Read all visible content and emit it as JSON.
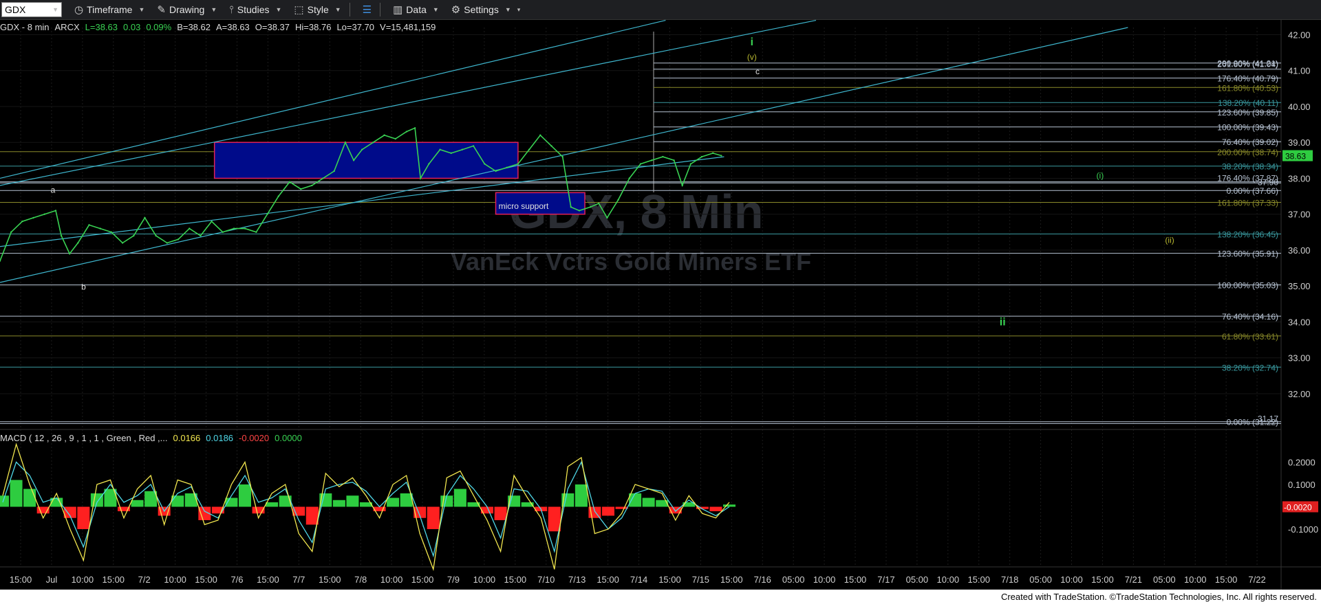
{
  "toolbar": {
    "symbol": "GDX",
    "items": [
      {
        "label": "Timeframe",
        "icon": "clock-icon"
      },
      {
        "label": "Drawing",
        "icon": "pencil-icon"
      },
      {
        "label": "Studies",
        "icon": "studies-icon"
      },
      {
        "label": "Style",
        "icon": "style-icon"
      },
      {
        "label": "",
        "icon": "layout-icon"
      },
      {
        "label": "Data",
        "icon": "data-icon"
      },
      {
        "label": "Settings",
        "icon": "gear-icon"
      }
    ]
  },
  "infobar": {
    "symbol": "GDX - 8 min",
    "exchange": "ARCX",
    "last": "L=38.63",
    "change": "0.03",
    "pct": "0.09%",
    "bid": "B=38.62",
    "ask": "A=38.63",
    "open": "O=38.37",
    "high": "Hi=38.76",
    "low": "Lo=37.70",
    "volume": "V=15,481,159"
  },
  "watermark": {
    "symbol": "GDX, 8 Min",
    "name": "VanEck Vctrs Gold Miners ETF"
  },
  "macd": {
    "label": "MACD ( 12 , 26 , 9 , 1 , 1 , Green , Red ,...",
    "macd_value": "0.0166",
    "signal_value": "0.0186",
    "hist_value": "-0.0020",
    "zero_value": "0.0000",
    "current_label": "-0.0020"
  },
  "footer": "Created with TradeStation. ©TradeStation Technologies, Inc. All rights reserved.",
  "colors": {
    "price": "#39d353",
    "channel": "#3fb8d0",
    "level_white": "#b8c4d4",
    "level_teal": "#3a9aa0",
    "level_olive": "#8a8a2a",
    "box_fill": "#000b8a",
    "box_border": "#e0205a",
    "macd_line": "#f2e74f",
    "signal_line": "#4fd8e8",
    "hist_pos": "#2ecc40",
    "hist_neg": "#ff2020"
  },
  "chart_data": {
    "type": "line",
    "title": "GDX - 8 min",
    "y_axis": {
      "ticks": [
        "42.00",
        "41.00",
        "40.00",
        "39.00",
        "38.00",
        "37.00",
        "36.00",
        "35.00",
        "34.00",
        "33.00",
        "32.00"
      ],
      "ylim": [
        31.1,
        42.2
      ]
    },
    "x_axis": {
      "ticks": [
        "15:00",
        "Jul",
        "10:00",
        "15:00",
        "7/2",
        "10:00",
        "15:00",
        "7/6",
        "15:00",
        "7/7",
        "15:00",
        "7/8",
        "10:00",
        "15:00",
        "7/9",
        "10:00",
        "15:00",
        "7/10",
        "7/13",
        "15:00",
        "7/14",
        "15:00",
        "7/15",
        "15:00",
        "7/16",
        "05:00",
        "10:00",
        "15:00",
        "7/17",
        "05:00",
        "10:00",
        "15:00",
        "7/18",
        "05:00",
        "10:00",
        "15:00",
        "7/21",
        "05:00",
        "10:00",
        "15:00",
        "7/22"
      ]
    },
    "current_price": "38.63",
    "price_series": [
      {
        "t": 0,
        "p": 35.7
      },
      {
        "t": 4,
        "p": 36.5
      },
      {
        "t": 8,
        "p": 36.8
      },
      {
        "t": 12,
        "p": 36.9
      },
      {
        "t": 16,
        "p": 37.0
      },
      {
        "t": 20,
        "p": 37.1
      },
      {
        "t": 22,
        "p": 36.4
      },
      {
        "t": 25,
        "p": 35.9
      },
      {
        "t": 28,
        "p": 36.2
      },
      {
        "t": 32,
        "p": 36.7
      },
      {
        "t": 36,
        "p": 36.6
      },
      {
        "t": 40,
        "p": 36.5
      },
      {
        "t": 44,
        "p": 36.2
      },
      {
        "t": 48,
        "p": 36.4
      },
      {
        "t": 52,
        "p": 36.9
      },
      {
        "t": 56,
        "p": 36.4
      },
      {
        "t": 60,
        "p": 36.2
      },
      {
        "t": 64,
        "p": 36.3
      },
      {
        "t": 68,
        "p": 36.6
      },
      {
        "t": 72,
        "p": 36.4
      },
      {
        "t": 76,
        "p": 36.8
      },
      {
        "t": 80,
        "p": 36.5
      },
      {
        "t": 84,
        "p": 36.6
      },
      {
        "t": 88,
        "p": 36.6
      },
      {
        "t": 92,
        "p": 36.5
      },
      {
        "t": 96,
        "p": 37.0
      },
      {
        "t": 100,
        "p": 37.5
      },
      {
        "t": 104,
        "p": 37.9
      },
      {
        "t": 108,
        "p": 37.7
      },
      {
        "t": 112,
        "p": 37.8
      },
      {
        "t": 116,
        "p": 38.0
      },
      {
        "t": 120,
        "p": 38.2
      },
      {
        "t": 124,
        "p": 39.0
      },
      {
        "t": 127,
        "p": 38.5
      },
      {
        "t": 130,
        "p": 38.8
      },
      {
        "t": 134,
        "p": 39.0
      },
      {
        "t": 138,
        "p": 39.2
      },
      {
        "t": 142,
        "p": 39.1
      },
      {
        "t": 146,
        "p": 39.3
      },
      {
        "t": 149,
        "p": 39.4
      },
      {
        "t": 151,
        "p": 38.0
      },
      {
        "t": 154,
        "p": 38.4
      },
      {
        "t": 158,
        "p": 38.8
      },
      {
        "t": 162,
        "p": 38.7
      },
      {
        "t": 166,
        "p": 38.8
      },
      {
        "t": 170,
        "p": 38.9
      },
      {
        "t": 174,
        "p": 38.4
      },
      {
        "t": 178,
        "p": 38.2
      },
      {
        "t": 182,
        "p": 38.3
      },
      {
        "t": 186,
        "p": 38.4
      },
      {
        "t": 190,
        "p": 38.8
      },
      {
        "t": 194,
        "p": 39.2
      },
      {
        "t": 198,
        "p": 38.9
      },
      {
        "t": 202,
        "p": 38.6
      },
      {
        "t": 205,
        "p": 37.2
      },
      {
        "t": 208,
        "p": 37.1
      },
      {
        "t": 212,
        "p": 37.2
      },
      {
        "t": 215,
        "p": 37.3
      },
      {
        "t": 218,
        "p": 36.9
      },
      {
        "t": 222,
        "p": 37.4
      },
      {
        "t": 226,
        "p": 38.0
      },
      {
        "t": 230,
        "p": 38.4
      },
      {
        "t": 234,
        "p": 38.5
      },
      {
        "t": 238,
        "p": 38.6
      },
      {
        "t": 242,
        "p": 38.5
      },
      {
        "t": 245,
        "p": 37.8
      },
      {
        "t": 248,
        "p": 38.4
      },
      {
        "t": 252,
        "p": 38.6
      },
      {
        "t": 256,
        "p": 38.7
      },
      {
        "t": 259,
        "p": 38.63
      }
    ],
    "horizontal_levels": [
      {
        "label": "200.00% (41.21)",
        "price": 41.21,
        "color": "white"
      },
      {
        "label": "261.80% (41.04)",
        "price": 41.04,
        "color": "white"
      },
      {
        "label": "176.40% (40.79)",
        "price": 40.79,
        "color": "white"
      },
      {
        "label": "161.80% (40.53)",
        "price": 40.53,
        "color": "olive"
      },
      {
        "label": "138.20% (40.11)",
        "price": 40.11,
        "color": "teal"
      },
      {
        "label": "123.60% (39.85)",
        "price": 39.85,
        "color": "white"
      },
      {
        "label": "100.00% (39.43)",
        "price": 39.43,
        "color": "white"
      },
      {
        "label": "76.40% (39.02)",
        "price": 39.02,
        "color": "white"
      },
      {
        "label": "200.00% (38.74)",
        "price": 38.74,
        "color": "olive"
      },
      {
        "label": "38.20% (38.34)",
        "price": 38.34,
        "color": "teal"
      },
      {
        "label": "37.90",
        "price": 37.9,
        "color": "white"
      },
      {
        "label": "176.40% (37.87)",
        "price": 37.87,
        "color": "white"
      },
      {
        "label": "0.00% (37.66)",
        "price": 37.66,
        "color": "white"
      },
      {
        "label": "161.80% (37.33)",
        "price": 37.33,
        "color": "olive"
      },
      {
        "label": "138.20% (36.45)",
        "price": 36.45,
        "color": "teal"
      },
      {
        "label": "123.60% (35.91)",
        "price": 35.91,
        "color": "white"
      },
      {
        "label": "100.00% (35.03)",
        "price": 35.03,
        "color": "white"
      },
      {
        "label": "76.40% (34.16)",
        "price": 34.16,
        "color": "white"
      },
      {
        "label": "61.80% (33.61)",
        "price": 33.61,
        "color": "olive"
      },
      {
        "label": "38.20% (32.74)",
        "price": 32.74,
        "color": "teal"
      },
      {
        "label": "0.00% (31.22)",
        "price": 31.22,
        "color": "white"
      },
      {
        "label": "31.17",
        "price": 31.17,
        "color": "white"
      }
    ],
    "annotations": [
      {
        "text": "a",
        "t": 19,
        "p": 37.6,
        "color": "white"
      },
      {
        "text": "b",
        "t": 30,
        "p": 34.9,
        "color": "white"
      },
      {
        "text": "micro support",
        "t": 188,
        "p": 37.15,
        "color": "white"
      },
      {
        "text": "i",
        "t": 270,
        "p": 41.7,
        "color": "green"
      },
      {
        "text": "(v)",
        "t": 270,
        "p": 41.3,
        "color": "olive"
      },
      {
        "text": "c",
        "t": 272,
        "p": 40.9,
        "color": "white"
      },
      {
        "text": "(i)",
        "t": 395,
        "p": 38.0,
        "color": "green"
      },
      {
        "text": "(ii)",
        "t": 420,
        "p": 36.2,
        "color": "olive"
      },
      {
        "text": "ii",
        "t": 360,
        "p": 33.9,
        "color": "green"
      }
    ],
    "boxes": [
      {
        "t0": 77,
        "t1": 186,
        "p_top": 39.0,
        "p_bot": 38.0,
        "fill": "blue"
      },
      {
        "t0": 178,
        "t1": 210,
        "p_top": 37.6,
        "p_bot": 37.0,
        "fill": "blue"
      }
    ],
    "channel_lines": [
      {
        "t0": 0,
        "p0": 38.0,
        "t1": 239,
        "p1": 42.4
      },
      {
        "t0": 0,
        "p0": 37.8,
        "t1": 293,
        "p1": 42.4
      },
      {
        "t0": 0,
        "p0": 35.1,
        "t1": 405,
        "p1": 42.2
      },
      {
        "t0": 0,
        "p0": 36.1,
        "t1": 260,
        "p1": 38.6
      }
    ],
    "macd": {
      "ylim": [
        -0.26,
        0.3
      ],
      "ticks": [
        "0.2000",
        "0.1000",
        "-0.1000"
      ],
      "histogram": [
        0.05,
        0.12,
        0.08,
        -0.03,
        0.04,
        -0.05,
        -0.1,
        0.06,
        0.08,
        -0.02,
        0.03,
        0.07,
        -0.04,
        0.05,
        0.06,
        -0.06,
        -0.03,
        0.04,
        0.1,
        -0.03,
        0.02,
        0.05,
        -0.04,
        -0.08,
        0.06,
        0.03,
        0.05,
        0.02,
        -0.02,
        0.04,
        0.06,
        -0.05,
        -0.1,
        0.05,
        0.08,
        0.02,
        -0.03,
        -0.06,
        0.05,
        0.02,
        -0.02,
        -0.11,
        0.06,
        0.1,
        -0.05,
        -0.04,
        -0.01,
        0.06,
        0.04,
        0.03,
        -0.03,
        0.02,
        -0.01,
        -0.02,
        0.01
      ],
      "macd_line": [
        0.05,
        0.28,
        0.1,
        -0.05,
        0.06,
        -0.1,
        -0.24,
        0.1,
        0.12,
        -0.05,
        0.08,
        0.14,
        -0.08,
        0.12,
        0.1,
        -0.08,
        -0.06,
        0.1,
        0.2,
        -0.05,
        0.06,
        0.1,
        -0.12,
        -0.2,
        0.15,
        0.09,
        0.13,
        0.05,
        -0.05,
        0.1,
        0.14,
        -0.12,
        -0.28,
        0.13,
        0.16,
        0.05,
        -0.06,
        -0.2,
        0.14,
        0.04,
        -0.05,
        -0.28,
        0.18,
        0.22,
        -0.12,
        -0.1,
        -0.03,
        0.1,
        0.08,
        0.06,
        -0.06,
        0.05,
        -0.03,
        -0.05,
        0.02
      ],
      "signal_line": [
        0.02,
        0.2,
        0.14,
        0.02,
        0.04,
        -0.04,
        -0.18,
        0.02,
        0.1,
        0.02,
        0.05,
        0.1,
        -0.02,
        0.06,
        0.09,
        -0.02,
        -0.05,
        0.05,
        0.14,
        0.02,
        0.04,
        0.08,
        -0.06,
        -0.16,
        0.08,
        0.1,
        0.11,
        0.07,
        0.0,
        0.06,
        0.11,
        -0.04,
        -0.22,
        0.05,
        0.14,
        0.08,
        0.0,
        -0.14,
        0.08,
        0.07,
        -0.01,
        -0.2,
        0.08,
        0.2,
        -0.02,
        -0.1,
        -0.05,
        0.06,
        0.08,
        0.07,
        -0.02,
        0.03,
        -0.01,
        -0.04,
        0.0
      ]
    }
  }
}
